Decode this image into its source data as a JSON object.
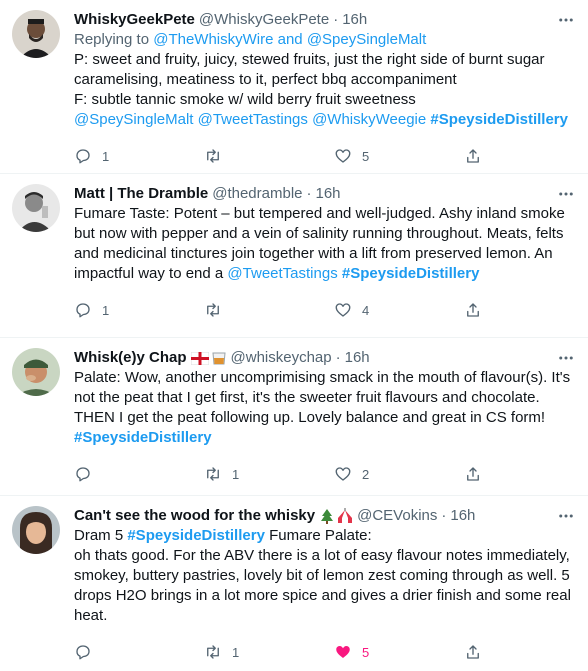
{
  "tweets": [
    {
      "name": "WhiskyGeekPete",
      "handle": "@WhiskyGeekPete",
      "sep": "·",
      "time": "16h",
      "reply_label": "Replying to ",
      "reply_link_1": "@TheWhiskyWire",
      "reply_and": " and ",
      "reply_link_2": "@SpeySingleMalt",
      "lines": [
        "P: sweet and fruity, juicy, stewed fruits, just the right side of burnt sugar caramelising, meatiness to it, perfect bbq accompaniment",
        "F: subtle tannic smoke w/ wild berry fruit sweetness"
      ],
      "mentions": [
        "@SpeySingleMalt",
        "@TweetTastings",
        "@WhiskyWeegie"
      ],
      "hashtag": "#SpeysideDistillery",
      "reply_count": "1",
      "retweet_count": "",
      "like_count": "5"
    },
    {
      "name": "Matt | The Dramble",
      "handle": "@thedramble",
      "sep": "·",
      "time": "16h",
      "text": "Fumare Taste: Potent – but tempered and well-judged. Ashy inland smoke but now with pepper and a vein of salinity running throughout. Meats, felts and medicinal tinctures join together with a lift from preserved lemon. An impactful way to end a ",
      "mention": "@TweetTastings",
      "hashtag": "#SpeysideDistillery",
      "reply_count": "1",
      "retweet_count": "",
      "like_count": "4"
    },
    {
      "name": "Whisk(e)y Chap",
      "handle": "@whiskeychap",
      "sep": "·",
      "time": "16h",
      "text": "Palate: Wow, another uncomprimising smack in the mouth of flavour(s). It's not the peat that I get first, it's the sweeter fruit flavours and chocolate. THEN I get the peat following up. Lovely balance and great in CS form!",
      "hashtag": "#SpeysideDistillery",
      "reply_count": "",
      "retweet_count": "1",
      "like_count": "2"
    },
    {
      "name": "Can't see the wood for the whisky",
      "handle": "@CEVokins",
      "sep": "·",
      "time": "16h",
      "text_pre": "Dram 5 ",
      "hashtag": "#SpeysideDistillery",
      "text_post": " Fumare Palate:",
      "text": "oh thats good. For the ABV there is a lot of easy flavour notes immediately, smokey, buttery pastries, lovely bit of lemon zest coming through as well. 5 drops H2O brings in a lot more spice and gives a drier finish and some real heat.",
      "reply_count": "",
      "retweet_count": "1",
      "like_count": "5"
    }
  ],
  "colors": {
    "text": "#0f1419",
    "secondary": "#536471",
    "link": "#1d9bf0",
    "like_active": "#f91880",
    "divider": "#eff3f4"
  }
}
